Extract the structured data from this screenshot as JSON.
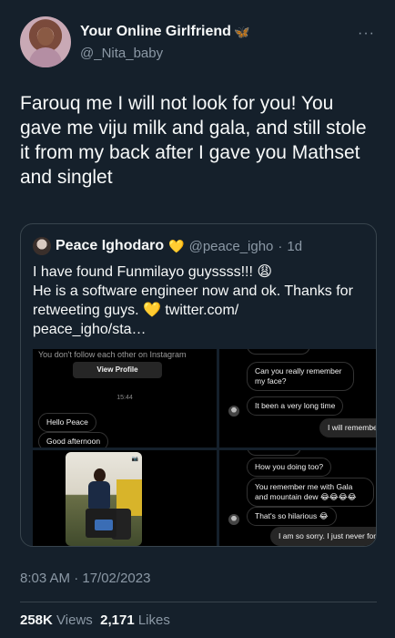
{
  "author": {
    "name": "Your Online Girlfriend",
    "handle": "@_Nita_baby",
    "badge": "🦋",
    "more": "···"
  },
  "tweet": {
    "text": "Farouq me I will not look for you! You gave me viju milk and gala, and still stole it from my back after I gave you Mathset and singlet"
  },
  "quote": {
    "name": "Peace Ighodaro",
    "badge": "💛",
    "handle": "@peace_igho",
    "separator": "·",
    "age": "1d",
    "text": "I have found Funmilayo guyssss!!! 😩\nHe is a software engineer now and ok. Thanks for retweeting guys. 💛  twitter.com/\npeace_igho/sta…",
    "media": {
      "panel1": {
        "note": "You don't follow each other on Instagram",
        "view_profile": "View Profile",
        "time": "15:44",
        "msg1": "Hello Peace",
        "msg2": "Good afternoon"
      },
      "panel2": {
        "msg1": "Can you really remember my face?",
        "msg2": "It been a very long time",
        "msg3": "I will remember"
      },
      "panel3": {
        "tag": "📷"
      },
      "panel4": {
        "msg1": "How you doing too?",
        "msg2": "You remember me with Gala and mountain dew 😂😂😂😂",
        "msg3": "That's so hilarious 😂",
        "msg4": "I am so sorry. I just never forgot."
      }
    }
  },
  "meta": {
    "timestamp": "8:03 AM · 17/02/2023",
    "views_count": "258K",
    "views_label": "Views",
    "likes_count": "2,171",
    "likes_label": "Likes"
  }
}
